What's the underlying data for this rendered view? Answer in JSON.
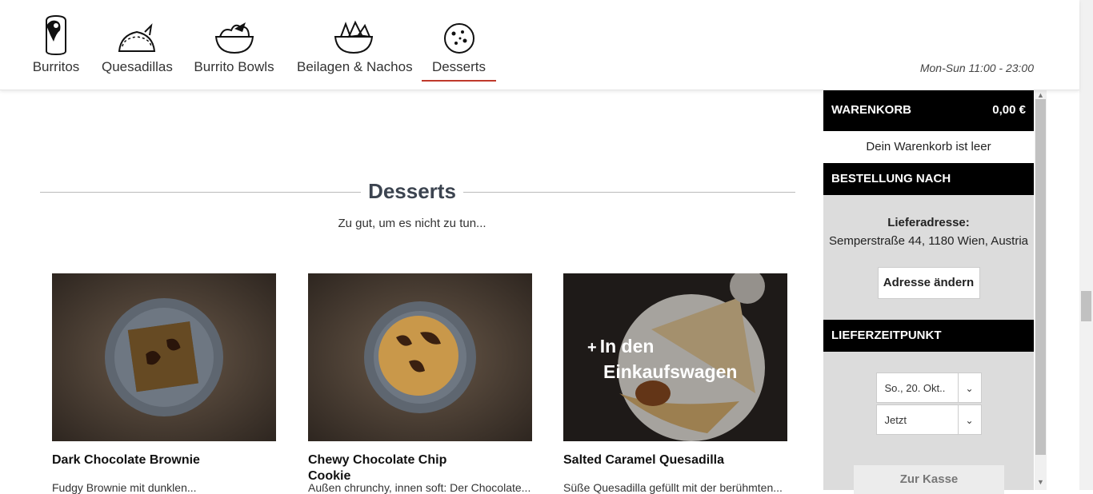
{
  "nav": {
    "items": [
      {
        "label": "Burritos",
        "icon": "burrito-icon"
      },
      {
        "label": "Quesadillas",
        "icon": "quesadilla-icon"
      },
      {
        "label": "Burrito Bowls",
        "icon": "bowl-icon"
      },
      {
        "label": "Beilagen & Nachos",
        "icon": "nachos-icon"
      },
      {
        "label": "Desserts",
        "icon": "cookie-icon",
        "active": true
      }
    ],
    "hours": "Mon-Sun 11:00 - 23:00",
    "accent_color": "#c0392b"
  },
  "main": {
    "partial_add_label": "+ In den Einkaufswagen",
    "section_title": "Desserts",
    "section_subtitle": "Zu gut, um es nicht zu tun...",
    "products": [
      {
        "name": "Dark Chocolate Brownie",
        "desc": "Fudgy Brownie mit dunklen..."
      },
      {
        "name": "Chewy Chocolate Chip Cookie",
        "desc": "Außen chrunchy, innen soft: Der Chocolate..."
      },
      {
        "name": "Salted Caramel Quesadilla",
        "desc": "Süße Quesadilla gefüllt mit der berühmten...",
        "add_label_1": "In den",
        "add_label_2": "Einkaufswagen",
        "add_plus": "+"
      }
    ]
  },
  "sidebar": {
    "cart_title": "WARENKORB",
    "cart_total": "0,00 €",
    "cart_empty": "Dein Warenkorb ist leer",
    "order_title": "BESTELLUNG NACH",
    "address_label": "Lieferadresse:",
    "address_value": "Semperstraße 44, 1180 Wien, Austria",
    "change_address": "Adresse ändern",
    "time_title": "LIEFERZEITPUNKT",
    "date_select": "So., 20. Okt..",
    "time_select": "Jetzt",
    "checkout": "Zur Kasse"
  }
}
